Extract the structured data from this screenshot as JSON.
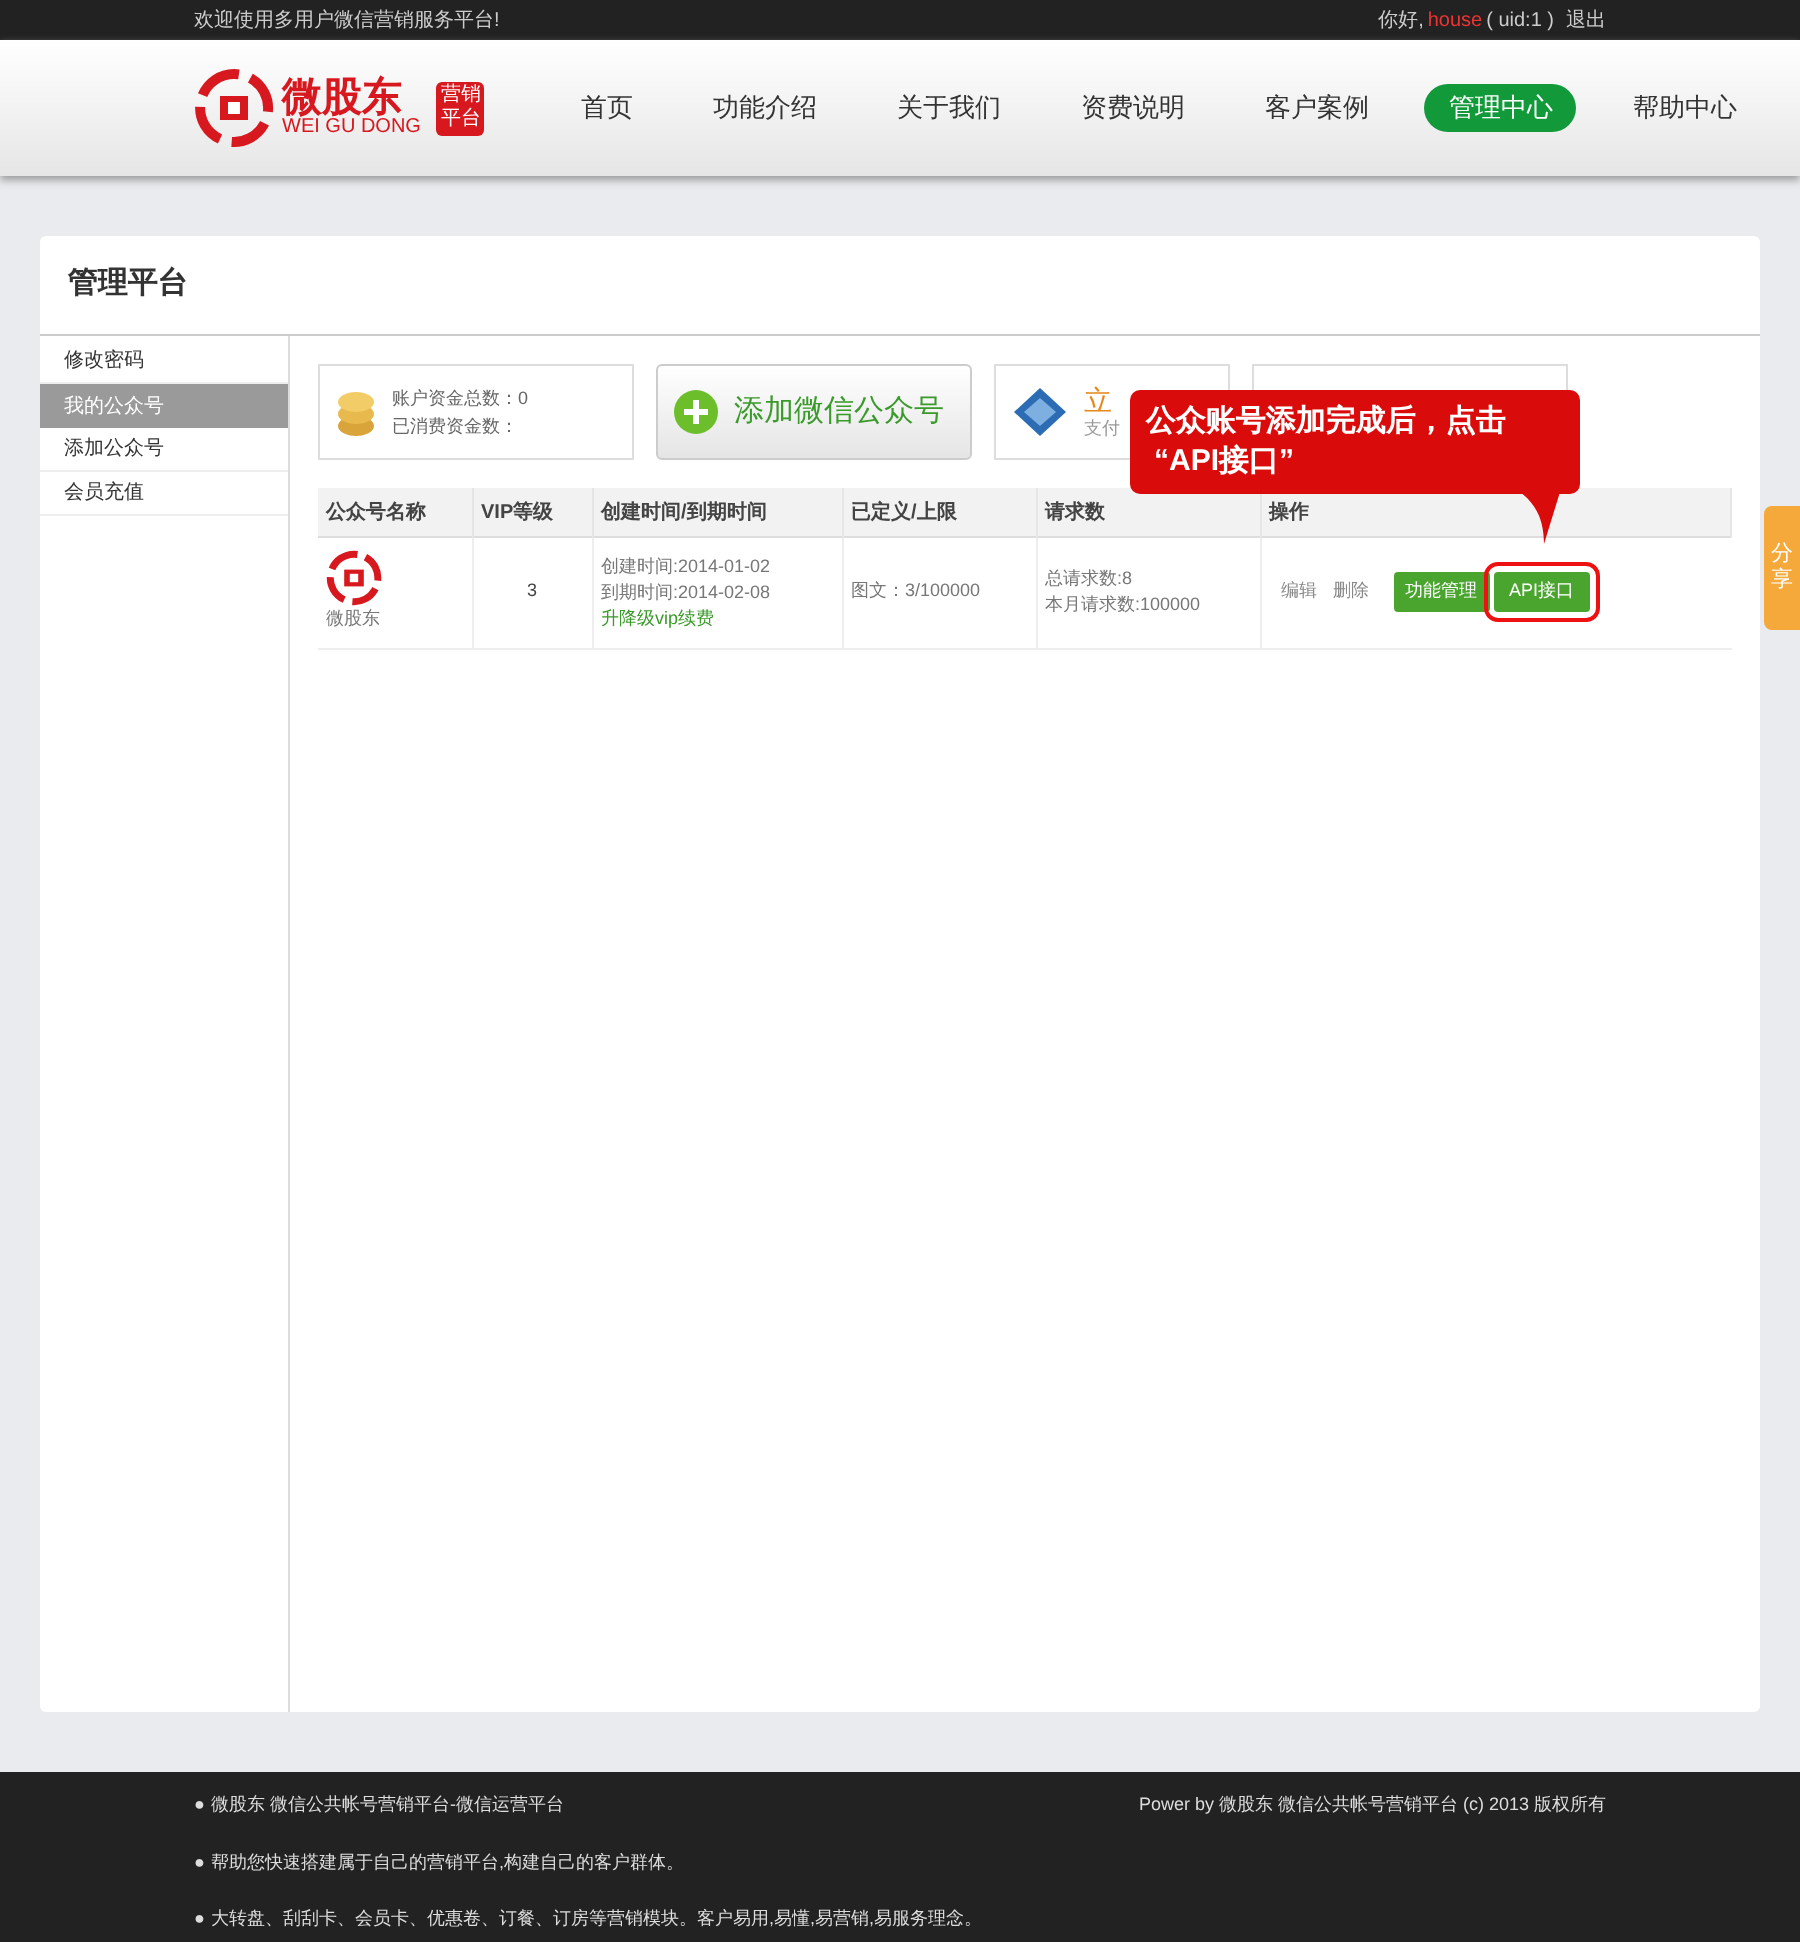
{
  "top_bar": {
    "welcome": "欢迎使用多用户微信营销服务平台!",
    "greeting": "你好,",
    "username": "house",
    "uid": "( uid:1 )",
    "logout": "退出"
  },
  "logo": {
    "name": "微股东",
    "pinyin": "WEI GU DONG",
    "badge_top": "营销",
    "badge_bottom": "平台"
  },
  "nav": [
    {
      "label": "首页",
      "selected": false
    },
    {
      "label": "功能介绍",
      "selected": false
    },
    {
      "label": "关于我们",
      "selected": false
    },
    {
      "label": "资费说明",
      "selected": false
    },
    {
      "label": "客户案例",
      "selected": false
    },
    {
      "label": "管理中心",
      "selected": true
    },
    {
      "label": "帮助中心",
      "selected": false
    }
  ],
  "panel_title": "管理平台",
  "sidebar": [
    {
      "label": "修改密码",
      "selected": false
    },
    {
      "label": "我的公众号",
      "selected": true
    },
    {
      "label": "添加公众号",
      "selected": false
    },
    {
      "label": "会员充值",
      "selected": false
    }
  ],
  "balance": {
    "total": "账户资金总数：0",
    "spent": "已消费资金数："
  },
  "add_button": "添加微信公众号",
  "pay_card": {
    "title": "立",
    "subtitle": "支付"
  },
  "table": {
    "columns": [
      "公众号名称",
      "VIP等级",
      "创建时间/到期时间",
      "已定义/上限",
      "请求数",
      "操作"
    ],
    "rows": [
      {
        "name": "微股东",
        "vip": "3",
        "created": "创建时间:2014-01-02",
        "expires": "到期时间:2014-02-08",
        "upgrade": "升降级vip续费",
        "defined": "图文：3/100000",
        "total_requests": "总请求数:8",
        "month_requests": "本月请求数:100000",
        "edit": "编辑",
        "delete": "删除",
        "manage": "功能管理",
        "api": "API接口"
      }
    ]
  },
  "callout": {
    "line1": "公众账号添加完成后，点击",
    "line2": "“API接口”"
  },
  "share_tab": "分享",
  "footer": {
    "bullet": "●",
    "lines": [
      "微股东 微信公共帐号营销平台-微信运营平台",
      "帮助您快速搭建属于自己的营销平台,构建自己的客户群体。",
      "大转盘、刮刮卡、会员卡、优惠卷、订餐、订房等营销模块。客户易用,易懂,易营销,易服务理念。"
    ],
    "copyright": "Power by 微股东 微信公共帐号营销平台 (c) 2013 版权所有"
  }
}
